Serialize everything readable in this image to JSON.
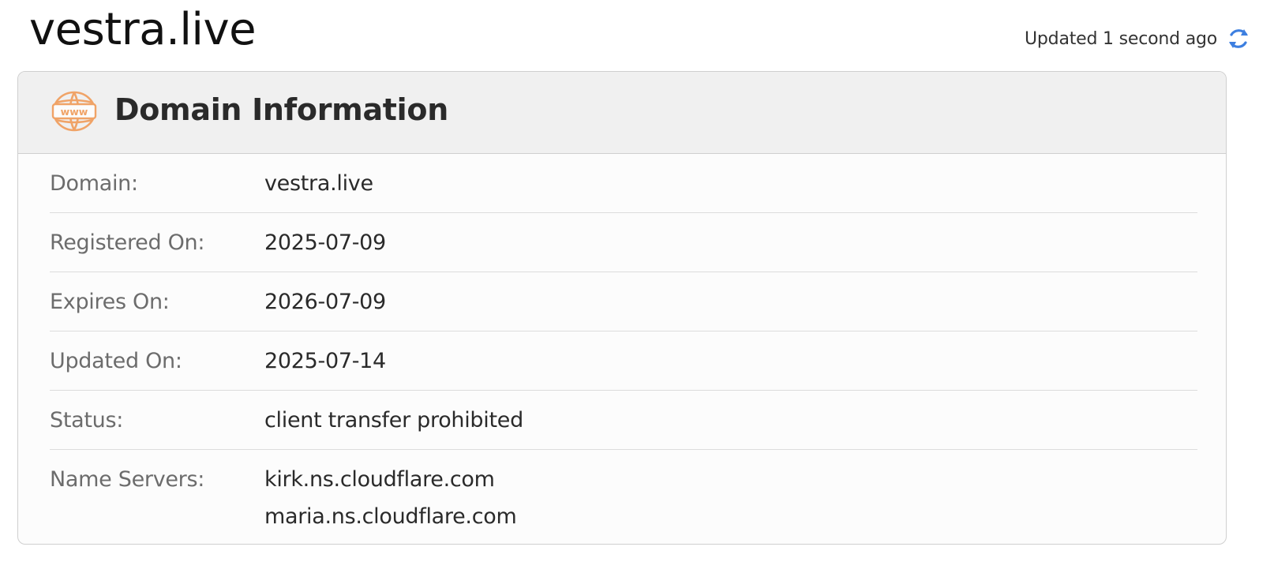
{
  "page": {
    "title": "vestra.live",
    "updated_text": "Updated 1 second ago"
  },
  "card": {
    "title": "Domain Information",
    "icon_text": "www",
    "accent_color": "#f0a367",
    "rows": [
      {
        "label": "Domain:",
        "value": "vestra.live"
      },
      {
        "label": "Registered On:",
        "value": "2025-07-09"
      },
      {
        "label": "Expires On:",
        "value": "2026-07-09"
      },
      {
        "label": "Updated On:",
        "value": "2025-07-14"
      },
      {
        "label": "Status:",
        "value": "client transfer prohibited"
      },
      {
        "label": "Name Servers:",
        "values": [
          "kirk.ns.cloudflare.com",
          "maria.ns.cloudflare.com"
        ]
      }
    ]
  },
  "icons": {
    "refresh": "refresh-icon",
    "www": "www-globe-icon"
  },
  "colors": {
    "refresh_icon": "#3d7fe0",
    "header_bg": "#f0f0f0",
    "label_text": "#6c6c6c",
    "value_text": "#2a2a2a"
  }
}
